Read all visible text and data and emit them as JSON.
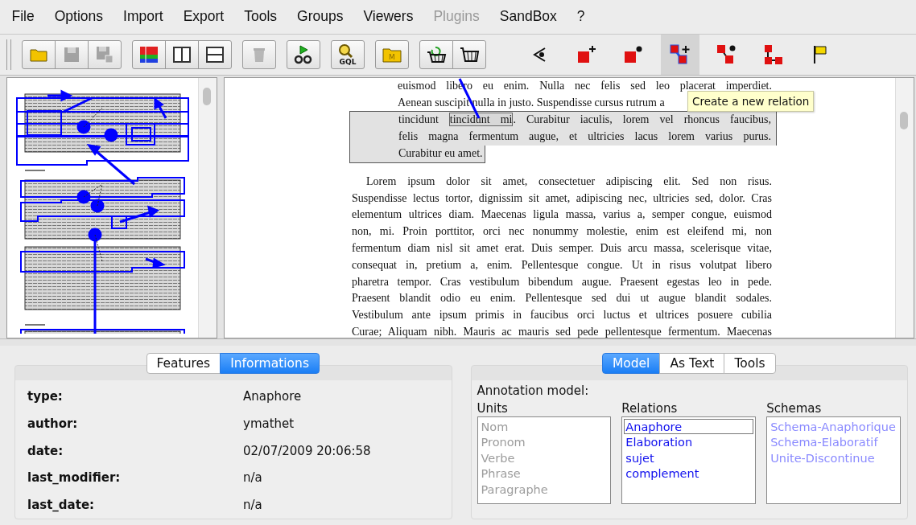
{
  "menu": [
    {
      "label": "File",
      "disabled": false
    },
    {
      "label": "Options",
      "disabled": false
    },
    {
      "label": "Import",
      "disabled": false
    },
    {
      "label": "Export",
      "disabled": false
    },
    {
      "label": "Tools",
      "disabled": false
    },
    {
      "label": "Groups",
      "disabled": false
    },
    {
      "label": "Viewers",
      "disabled": false
    },
    {
      "label": "Plugins",
      "disabled": true
    },
    {
      "label": "SandBox",
      "disabled": false
    },
    {
      "label": "?",
      "disabled": false
    }
  ],
  "toolbar": [
    {
      "buttons": [
        {
          "kind": "folder",
          "disabled": false,
          "selected": false
        },
        {
          "kind": "save",
          "disabled": true,
          "selected": false
        },
        {
          "kind": "save-as",
          "disabled": true,
          "selected": false
        }
      ]
    },
    {
      "buttons": [
        {
          "kind": "color-bars",
          "disabled": false,
          "selected": false
        },
        {
          "kind": "two-columns",
          "disabled": false,
          "selected": false
        },
        {
          "kind": "two-rows",
          "disabled": false,
          "selected": false
        }
      ]
    },
    {
      "buttons": [
        {
          "kind": "trash",
          "disabled": true,
          "selected": false
        }
      ]
    },
    {
      "buttons": [
        {
          "kind": "play-search",
          "disabled": false,
          "selected": false
        }
      ]
    },
    {
      "buttons": [
        {
          "kind": "query",
          "label": "GQL",
          "disabled": false,
          "selected": false
        }
      ]
    },
    {
      "buttons": [
        {
          "kind": "folder-letter",
          "label": "M",
          "disabled": false,
          "selected": false
        }
      ]
    },
    {
      "buttons": [
        {
          "kind": "basket-refresh",
          "disabled": false,
          "selected": false
        },
        {
          "kind": "basket",
          "disabled": false,
          "selected": false
        }
      ]
    },
    {
      "buttons": [
        {
          "kind": "eye-arrow",
          "disabled": false,
          "selected": false
        },
        {
          "kind": "unit-add",
          "disabled": false,
          "selected": false
        },
        {
          "kind": "unit-dot",
          "disabled": false,
          "selected": false
        },
        {
          "kind": "relation-add",
          "disabled": false,
          "selected": true
        },
        {
          "kind": "relation-dot",
          "disabled": false,
          "selected": false
        },
        {
          "kind": "tree",
          "disabled": false,
          "selected": false
        },
        {
          "kind": "flag",
          "disabled": false,
          "selected": false
        }
      ]
    }
  ],
  "tooltip": "Create a new relation",
  "document": [
    {
      "kind": "block",
      "lines": [
        {
          "annotated": false,
          "justified": true,
          "parts": [
            {
              "text": "euismod libero eu enim. Nulla nec felis sed leo placerat imperdiet.",
              "boxed": false
            }
          ]
        },
        {
          "annotated": false,
          "justified": false,
          "parts": [
            {
              "text": "Aenean suscipit nulla in justo. Suspendisse cursus rutrum a",
              "boxed": false
            }
          ]
        },
        {
          "annotated": true,
          "justified": true,
          "parts": [
            {
              "text": "tincidunt ",
              "boxed": false
            },
            {
              "text": "tincidunt mi",
              "boxed": true
            },
            {
              "text": ". Curabitur iaculis, lorem vel rhoncus faucibus,",
              "boxed": false
            }
          ]
        },
        {
          "annotated": true,
          "justified": true,
          "parts": [
            {
              "text": "felis magna fermentum augue, et ultricies lacus lorem varius purus.",
              "boxed": false
            }
          ]
        },
        {
          "annotated": true,
          "justified": false,
          "parts": [
            {
              "text": "Curabitur eu amet.",
              "boxed": false
            }
          ]
        }
      ]
    },
    {
      "kind": "body",
      "lines": [
        {
          "annotated": false,
          "justified": true,
          "parts": [
            {
              "text": "Lorem ipsum dolor sit amet, consectetuer adipiscing elit. Sed non risus.",
              "boxed": false
            }
          ]
        },
        {
          "annotated": false,
          "justified": true,
          "parts": [
            {
              "text": "Suspendisse lectus tortor, dignissim sit amet, adipiscing nec, ultricies sed, dolor. Cras",
              "boxed": false
            }
          ]
        },
        {
          "annotated": false,
          "justified": true,
          "parts": [
            {
              "text": "elementum ultrices diam. Maecenas ligula massa, varius a, semper congue, euismod",
              "boxed": false
            }
          ]
        },
        {
          "annotated": false,
          "justified": true,
          "parts": [
            {
              "text": "non, mi. Proin porttitor, orci nec nonummy molestie, enim est eleifend mi, non",
              "boxed": false
            }
          ]
        },
        {
          "annotated": false,
          "justified": true,
          "parts": [
            {
              "text": "fermentum diam nisl sit amet erat. Duis semper. Duis arcu massa, scelerisque vitae,",
              "boxed": false
            }
          ]
        },
        {
          "annotated": false,
          "justified": true,
          "parts": [
            {
              "text": "consequat in, pretium a, enim. Pellentesque congue. Ut in risus volutpat libero",
              "boxed": false
            }
          ]
        },
        {
          "annotated": false,
          "justified": true,
          "parts": [
            {
              "text": "pharetra tempor. Cras vestibulum bibendum augue. Praesent egestas leo in pede.",
              "boxed": false
            }
          ]
        },
        {
          "annotated": false,
          "justified": true,
          "parts": [
            {
              "text": "Praesent blandit odio eu enim. Pellentesque sed dui ut augue blandit sodales.",
              "boxed": false
            }
          ]
        },
        {
          "annotated": false,
          "justified": true,
          "parts": [
            {
              "text": "Vestibulum ante ipsum primis in faucibus orci luctus et ultrices posuere cubilia",
              "boxed": false
            }
          ]
        },
        {
          "annotated": false,
          "justified": true,
          "parts": [
            {
              "text": "Curae; Aliquam nibh. Mauris ac mauris sed pede pellentesque fermentum. Maecenas",
              "boxed": false
            }
          ]
        }
      ]
    }
  ],
  "info_panel": {
    "tabs": [
      {
        "label": "Features",
        "selected": false
      },
      {
        "label": "Informations",
        "selected": true
      }
    ],
    "rows": [
      {
        "label": "type:",
        "value": "Anaphore"
      },
      {
        "label": "author:",
        "value": "ymathet"
      },
      {
        "label": "date:",
        "value": "02/07/2009 20:06:58"
      },
      {
        "label": "last_modifier:",
        "value": "n/a"
      },
      {
        "label": "last_date:",
        "value": "n/a"
      }
    ]
  },
  "model_panel": {
    "tabs": [
      {
        "label": "Model",
        "selected": true
      },
      {
        "label": "As Text",
        "selected": false
      },
      {
        "label": "Tools",
        "selected": false
      }
    ],
    "heading": "Annotation model:",
    "columns": [
      {
        "title": "Units",
        "kind": "inactive",
        "items": [
          {
            "label": "Nom",
            "selected": false
          },
          {
            "label": "Pronom",
            "selected": false
          },
          {
            "label": "Verbe",
            "selected": false
          },
          {
            "label": "Phrase",
            "selected": false
          },
          {
            "label": "Paragraphe",
            "selected": false
          }
        ]
      },
      {
        "title": "Relations",
        "kind": "active",
        "items": [
          {
            "label": "Anaphore",
            "selected": true
          },
          {
            "label": "Elaboration",
            "selected": false
          },
          {
            "label": "sujet",
            "selected": false
          },
          {
            "label": "complement",
            "selected": false
          }
        ]
      },
      {
        "title": "Schemas",
        "kind": "muted",
        "items": [
          {
            "label": "Schema-Anaphorique",
            "selected": false
          },
          {
            "label": "Schema-Elaboratif",
            "selected": false
          },
          {
            "label": "Unite-Discontinue",
            "selected": false
          }
        ]
      }
    ]
  }
}
